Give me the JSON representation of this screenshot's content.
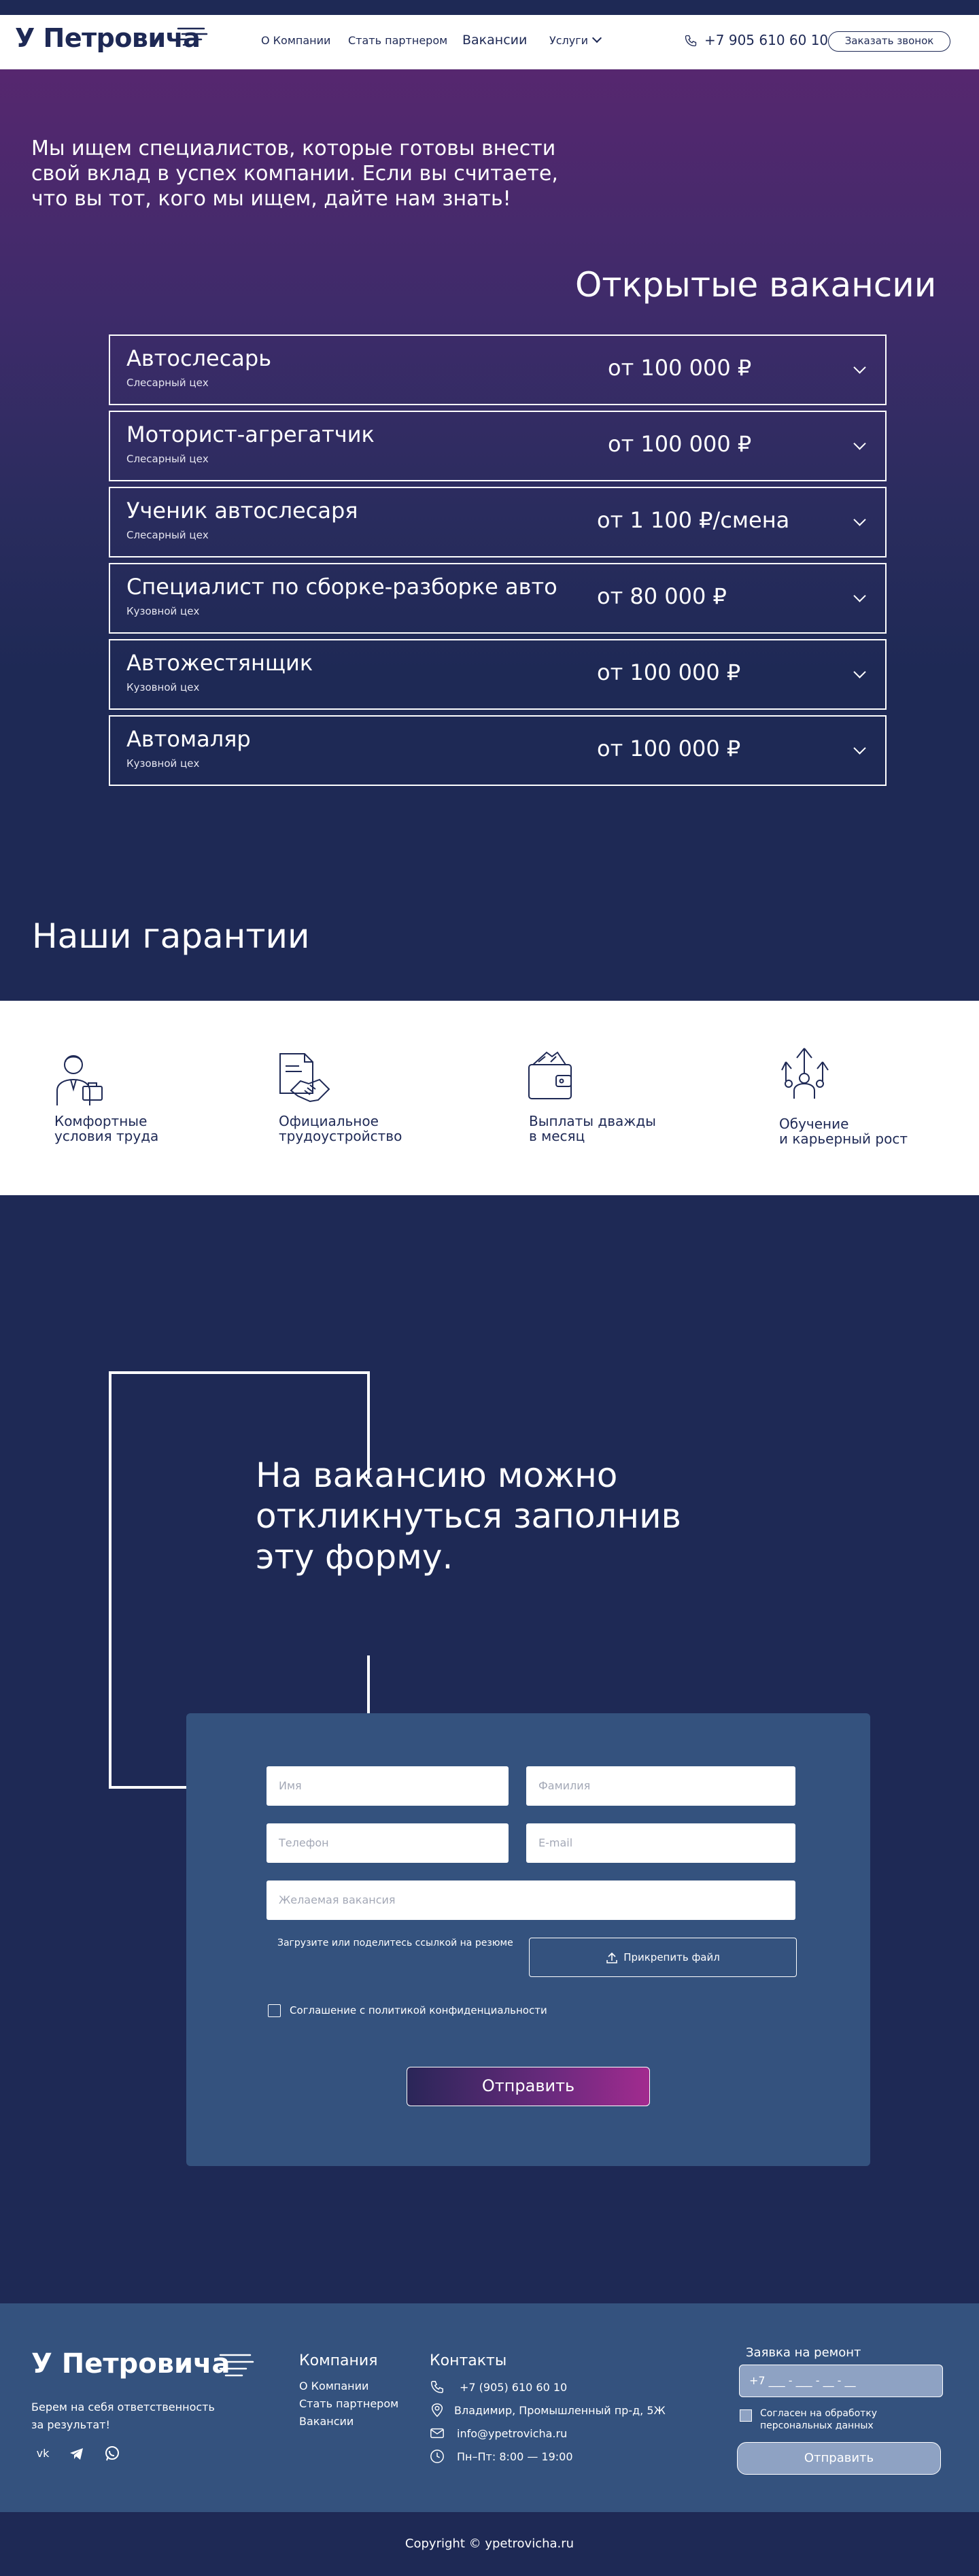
{
  "header": {
    "logo": "У Петровича",
    "nav": [
      "О Компании",
      "Стать партнером",
      "Вакансии",
      "Услуги"
    ],
    "phone": "+7 905 610 60 10",
    "callback": "Заказать звонок"
  },
  "hero": {
    "intro": "Мы ищем специалистов, которые готовы внести свой вклад в успех компании. Если вы считаете, что вы тот, кого мы ищем, дайте нам знать!",
    "vacancies_title": "Открытые вакансии"
  },
  "vacancies": [
    {
      "name": "Автослесарь",
      "dept": "Слесарный цех",
      "salary": "от 100 000 ₽"
    },
    {
      "name": "Моторист-агрегатчик",
      "dept": "Слесарный цех",
      "salary": "от 100 000 ₽"
    },
    {
      "name": "Ученик автослесаря",
      "dept": "Слесарный цех",
      "salary": "от 1 100 ₽/смена"
    },
    {
      "name": "Специалист по сборке-разборке авто",
      "dept": "Кузовной цех",
      "salary": "от 80 000 ₽"
    },
    {
      "name": "Автожестянщик",
      "dept": "Кузовной цех",
      "salary": "от 100 000 ₽"
    },
    {
      "name": "Автомаляр",
      "dept": "Кузовной цех",
      "salary": "от 100 000 ₽"
    }
  ],
  "guarantees": {
    "title": "Наши гарантии",
    "items": [
      {
        "line1": "Комфортные",
        "line2": "условия труда",
        "icon": "worker-icon"
      },
      {
        "line1": "Официальное",
        "line2": "трудоустройство",
        "icon": "handshake-document-icon"
      },
      {
        "line1": "Выплаты дважды",
        "line2": "в месяц",
        "icon": "wallet-icon"
      },
      {
        "line1": "Обучение",
        "line2": "и карьерный рост",
        "icon": "career-growth-icon"
      }
    ]
  },
  "form": {
    "title": "На вакансию можно откликнуться заполнив эту форму.",
    "first_name": "Имя",
    "last_name": "Фамилия",
    "phone": "Телефон",
    "email": "E-mail",
    "vacancy": "Желаемая вакансия",
    "resume_label": "Загрузите или поделитесь ссылкой на резюме",
    "attach": "Прикрепить файл",
    "agree": "Соглашение с политикой конфиденциальности",
    "submit": "Отправить"
  },
  "footer": {
    "logo": "У Петровича",
    "tagline": "Берем на себя ответственность за результат!",
    "company_title": "Компания",
    "company_links": [
      "О Компании",
      "Стать партнером",
      "Вакансии"
    ],
    "contacts_title": "Контакты",
    "contacts": [
      {
        "icon": "phone-icon",
        "text": "+7 (905) 610 60 10"
      },
      {
        "icon": "location-icon",
        "text": "Владимир, Промышленный пр-д, 5Ж"
      },
      {
        "icon": "mail-icon",
        "text": "info@ypetrovicha.ru"
      },
      {
        "icon": "clock-icon",
        "text": "Пн–Пт: 8:00 — 19:00"
      }
    ],
    "request_title": "Заявка на ремонт",
    "request_placeholder": "+7 ___ - ___ - __ - __",
    "request_agree": "Согласен на обработку персональных данных",
    "request_send": "Отправить",
    "copyright": "Copyright © ypetrovicha.ru"
  },
  "colors": {
    "navy": "#1e2955",
    "purple": "#56276f",
    "card": "#34527e",
    "accent": "#a22b8f"
  }
}
